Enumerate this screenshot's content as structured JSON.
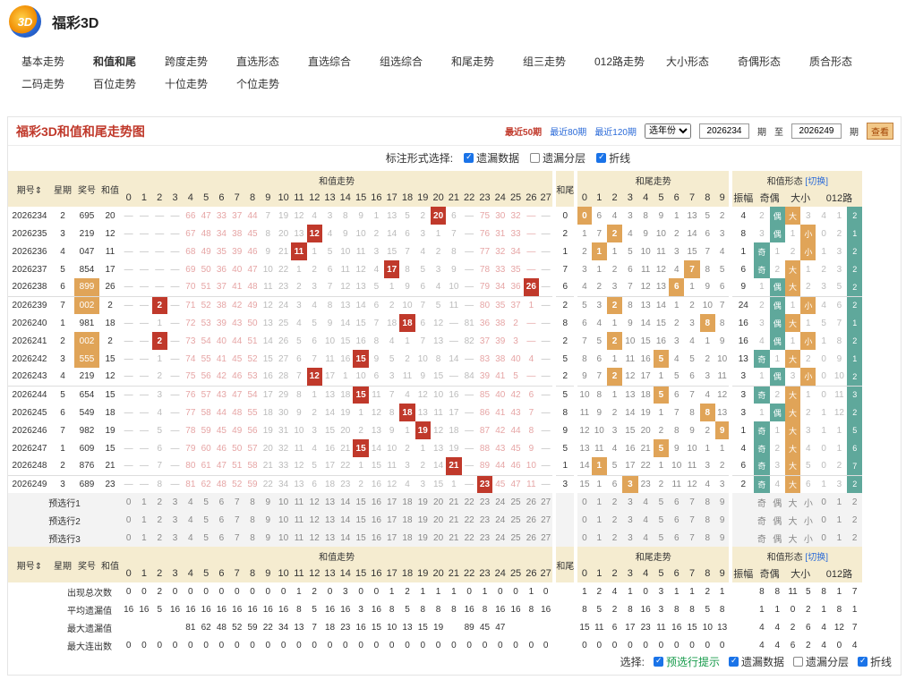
{
  "brand": {
    "logo": "3D",
    "name": "福彩3D"
  },
  "nav": [
    [
      "基本走势",
      "和值和尾",
      "跨度走势",
      "直选形态",
      "直选综合",
      "组选综合",
      "和尾走势",
      "组三走势",
      "012路走势",
      "大小形态",
      "奇偶形态",
      "质合形态"
    ],
    [
      "二码走势",
      "百位走势",
      "十位走势",
      "个位走势"
    ]
  ],
  "panel": {
    "title": "福彩3D和值和尾走势图",
    "p50": "最近50期",
    "p80": "最近80期",
    "p120": "最近120期",
    "year": "选年份",
    "from": "2026234",
    "mid1": "期",
    "to_label": "至",
    "to": "2026249",
    "mid2": "期",
    "go": "查看"
  },
  "opts": {
    "label": "标注形式选择:",
    "o1": "遗漏数据",
    "o2": "遗漏分层",
    "o3": "折线"
  },
  "head": {
    "issue": "期号",
    "week": "星期",
    "num": "奖号",
    "sum": "和值",
    "sumtrend": "和值走势",
    "tail": "和尾",
    "tailtrend": "和尾走势",
    "form": "和值形态",
    "switch": "[切换]",
    "amp": "振幅",
    "oe": "奇偶",
    "bs": "大小",
    "r012": "012路"
  },
  "rows": [
    {
      "i": "2026234",
      "w": "2",
      "n": "695",
      "s": 20,
      "miss": [
        "—",
        "—",
        "—",
        "—",
        "66",
        "47",
        "33",
        "37",
        "44",
        "7",
        "19",
        "12",
        "4",
        "3",
        "8",
        "9",
        "1",
        "13",
        "5",
        "2",
        "20",
        "6",
        "—",
        "75",
        "30",
        "32",
        "—",
        "—"
      ],
      "t": 0,
      "tm": [
        "0",
        "6",
        "4",
        "3",
        "8",
        "9",
        "1",
        "13",
        "5",
        "2"
      ],
      "a": "4",
      "oe": [
        "2",
        "偶"
      ],
      "bs": [
        "大",
        "3"
      ],
      "r": [
        "4",
        "1",
        "2"
      ]
    },
    {
      "i": "2026235",
      "w": "3",
      "n": "219",
      "s": 12,
      "miss": [
        "—",
        "—",
        "—",
        "—",
        "67",
        "48",
        "34",
        "38",
        "45",
        "8",
        "20",
        "13",
        "12",
        "4",
        "9",
        "10",
        "2",
        "14",
        "6",
        "3",
        "1",
        "7",
        "—",
        "76",
        "31",
        "33",
        "—",
        "—"
      ],
      "t": 2,
      "tm": [
        "1",
        "7",
        "2",
        "4",
        "9",
        "10",
        "2",
        "14",
        "6",
        "3"
      ],
      "a": "8",
      "oe": [
        "3",
        "偶"
      ],
      "bs": [
        "1",
        "小"
      ],
      "r": [
        "0",
        "2",
        "1"
      ]
    },
    {
      "i": "2026236",
      "w": "4",
      "n": "047",
      "s": 11,
      "miss": [
        "—",
        "—",
        "—",
        "—",
        "68",
        "49",
        "35",
        "39",
        "46",
        "9",
        "21",
        "11",
        "1",
        "5",
        "10",
        "11",
        "3",
        "15",
        "7",
        "4",
        "2",
        "8",
        "—",
        "77",
        "32",
        "34",
        "—",
        "—"
      ],
      "t": 1,
      "tm": [
        "2",
        "1",
        "1",
        "5",
        "10",
        "11",
        "3",
        "15",
        "7",
        "4"
      ],
      "a": "1",
      "oe": [
        "奇",
        "1"
      ],
      "bs": [
        "2",
        "小"
      ],
      "r": [
        "1",
        "3",
        "2"
      ]
    },
    {
      "i": "2026237",
      "w": "5",
      "n": "854",
      "s": 17,
      "miss": [
        "—",
        "—",
        "—",
        "—",
        "69",
        "50",
        "36",
        "40",
        "47",
        "10",
        "22",
        "1",
        "2",
        "6",
        "11",
        "12",
        "4",
        "17",
        "8",
        "5",
        "3",
        "9",
        "—",
        "78",
        "33",
        "35",
        "—",
        "—"
      ],
      "t": 7,
      "tm": [
        "3",
        "1",
        "2",
        "6",
        "11",
        "12",
        "4",
        "7",
        "8",
        "5"
      ],
      "a": "6",
      "oe": [
        "奇",
        "2"
      ],
      "bs": [
        "大",
        "1"
      ],
      "r": [
        "2",
        "3",
        "2"
      ]
    },
    {
      "i": "2026238",
      "w": "6",
      "n": "899",
      "s": 26,
      "miss": [
        "—",
        "—",
        "—",
        "—",
        "70",
        "51",
        "37",
        "41",
        "48",
        "11",
        "23",
        "2",
        "3",
        "7",
        "12",
        "13",
        "5",
        "1",
        "9",
        "6",
        "4",
        "10",
        "—",
        "79",
        "34",
        "36",
        "26",
        "—"
      ],
      "t": 6,
      "tm": [
        "4",
        "2",
        "3",
        "7",
        "12",
        "13",
        "6",
        "1",
        "9",
        "6"
      ],
      "a": "9",
      "oe": [
        "1",
        "偶"
      ],
      "bs": [
        "大",
        "2"
      ],
      "r": [
        "3",
        "5",
        "2"
      ]
    },
    {
      "i": "2026239",
      "w": "7",
      "n": "002",
      "s": 2,
      "miss": [
        "—",
        "—",
        "2",
        "—",
        "71",
        "52",
        "38",
        "42",
        "49",
        "12",
        "24",
        "3",
        "4",
        "8",
        "13",
        "14",
        "6",
        "2",
        "10",
        "7",
        "5",
        "11",
        "—",
        "80",
        "35",
        "37",
        "1",
        "—"
      ],
      "t": 2,
      "tm": [
        "5",
        "3",
        "2",
        "8",
        "13",
        "14",
        "1",
        "2",
        "10",
        "7"
      ],
      "a": "24",
      "oe": [
        "2",
        "偶"
      ],
      "bs": [
        "1",
        "小"
      ],
      "r": [
        "4",
        "6",
        "2"
      ]
    },
    {
      "i": "2026240",
      "w": "1",
      "n": "981",
      "s": 18,
      "miss": [
        "—",
        "—",
        "1",
        "—",
        "72",
        "53",
        "39",
        "43",
        "50",
        "13",
        "25",
        "4",
        "5",
        "9",
        "14",
        "15",
        "7",
        "18",
        "8",
        "6",
        "12",
        "—",
        "81",
        "36",
        "38",
        "2",
        "—",
        "—"
      ],
      "t": 8,
      "tm": [
        "6",
        "4",
        "1",
        "9",
        "14",
        "15",
        "2",
        "3",
        "8",
        "8"
      ],
      "a": "16",
      "oe": [
        "3",
        "偶"
      ],
      "bs": [
        "大",
        "1"
      ],
      "r": [
        "5",
        "7",
        "1"
      ]
    },
    {
      "i": "2026241",
      "w": "2",
      "n": "002",
      "s": 2,
      "miss": [
        "—",
        "—",
        "2",
        "—",
        "73",
        "54",
        "40",
        "44",
        "51",
        "14",
        "26",
        "5",
        "6",
        "10",
        "15",
        "16",
        "8",
        "4",
        "1",
        "7",
        "13",
        "—",
        "82",
        "37",
        "39",
        "3",
        "—",
        "—"
      ],
      "t": 2,
      "tm": [
        "7",
        "5",
        "2",
        "10",
        "15",
        "16",
        "3",
        "4",
        "1",
        "9"
      ],
      "a": "16",
      "oe": [
        "4",
        "偶"
      ],
      "bs": [
        "1",
        "小"
      ],
      "r": [
        "1",
        "8",
        "2"
      ]
    },
    {
      "i": "2026242",
      "w": "3",
      "n": "555",
      "s": 15,
      "miss": [
        "—",
        "—",
        "1",
        "—",
        "74",
        "55",
        "41",
        "45",
        "52",
        "15",
        "27",
        "6",
        "7",
        "11",
        "16",
        "15",
        "9",
        "5",
        "2",
        "10",
        "8",
        "14",
        "—",
        "83",
        "38",
        "40",
        "4",
        "—"
      ],
      "t": 5,
      "tm": [
        "8",
        "6",
        "1",
        "11",
        "16",
        "5",
        "4",
        "5",
        "2",
        "10"
      ],
      "a": "13",
      "oe": [
        "奇",
        "1"
      ],
      "bs": [
        "大",
        "2"
      ],
      "r": [
        "0",
        "9",
        "1"
      ]
    },
    {
      "i": "2026243",
      "w": "4",
      "n": "219",
      "s": 12,
      "miss": [
        "—",
        "—",
        "2",
        "—",
        "75",
        "56",
        "42",
        "46",
        "53",
        "16",
        "28",
        "7",
        "12",
        "17",
        "1",
        "10",
        "6",
        "3",
        "11",
        "9",
        "15",
        "—",
        "84",
        "39",
        "41",
        "5",
        "—",
        "—"
      ],
      "t": 2,
      "tm": [
        "9",
        "7",
        "2",
        "12",
        "17",
        "1",
        "5",
        "6",
        "3",
        "11"
      ],
      "a": "3",
      "oe": [
        "1",
        "偶"
      ],
      "bs": [
        "3",
        "小"
      ],
      "r": [
        "0",
        "10",
        "2"
      ]
    },
    {
      "i": "2026244",
      "w": "5",
      "n": "654",
      "s": 15,
      "miss": [
        "—",
        "—",
        "3",
        "—",
        "76",
        "57",
        "43",
        "47",
        "54",
        "17",
        "29",
        "8",
        "1",
        "13",
        "18",
        "15",
        "11",
        "7",
        "4",
        "12",
        "10",
        "16",
        "—",
        "85",
        "40",
        "42",
        "6",
        "—"
      ],
      "t": 5,
      "tm": [
        "10",
        "8",
        "1",
        "13",
        "18",
        "5",
        "6",
        "7",
        "4",
        "12"
      ],
      "a": "3",
      "oe": [
        "奇",
        "2"
      ],
      "bs": [
        "大",
        "1"
      ],
      "r": [
        "0",
        "11",
        "3"
      ]
    },
    {
      "i": "2026245",
      "w": "6",
      "n": "549",
      "s": 18,
      "miss": [
        "—",
        "—",
        "4",
        "—",
        "77",
        "58",
        "44",
        "48",
        "55",
        "18",
        "30",
        "9",
        "2",
        "14",
        "19",
        "1",
        "12",
        "8",
        "18",
        "13",
        "11",
        "17",
        "—",
        "86",
        "41",
        "43",
        "7",
        "—"
      ],
      "t": 8,
      "tm": [
        "11",
        "9",
        "2",
        "14",
        "19",
        "1",
        "7",
        "8",
        "8",
        "13"
      ],
      "a": "3",
      "oe": [
        "1",
        "偶"
      ],
      "bs": [
        "大",
        "2"
      ],
      "r": [
        "1",
        "12",
        "2"
      ]
    },
    {
      "i": "2026246",
      "w": "7",
      "n": "982",
      "s": 19,
      "miss": [
        "—",
        "—",
        "5",
        "—",
        "78",
        "59",
        "45",
        "49",
        "56",
        "19",
        "31",
        "10",
        "3",
        "15",
        "20",
        "2",
        "13",
        "9",
        "1",
        "19",
        "12",
        "18",
        "—",
        "87",
        "42",
        "44",
        "8",
        "—"
      ],
      "t": 9,
      "tm": [
        "12",
        "10",
        "3",
        "15",
        "20",
        "2",
        "8",
        "9",
        "2",
        "9"
      ],
      "a": "1",
      "oe": [
        "奇",
        "1"
      ],
      "bs": [
        "大",
        "3"
      ],
      "r": [
        "1",
        "1",
        "5"
      ]
    },
    {
      "i": "2026247",
      "w": "1",
      "n": "609",
      "s": 15,
      "miss": [
        "—",
        "—",
        "6",
        "—",
        "79",
        "60",
        "46",
        "50",
        "57",
        "20",
        "32",
        "11",
        "4",
        "16",
        "21",
        "15",
        "14",
        "10",
        "2",
        "1",
        "13",
        "19",
        "—",
        "88",
        "43",
        "45",
        "9",
        "—"
      ],
      "t": 5,
      "tm": [
        "13",
        "11",
        "4",
        "16",
        "21",
        "5",
        "9",
        "10",
        "1",
        "1"
      ],
      "a": "4",
      "oe": [
        "奇",
        "2"
      ],
      "bs": [
        "大",
        "4"
      ],
      "r": [
        "0",
        "1",
        "6"
      ]
    },
    {
      "i": "2026248",
      "w": "2",
      "n": "876",
      "s": 21,
      "miss": [
        "—",
        "—",
        "7",
        "—",
        "80",
        "61",
        "47",
        "51",
        "58",
        "21",
        "33",
        "12",
        "5",
        "17",
        "22",
        "1",
        "15",
        "11",
        "3",
        "2",
        "14",
        "21",
        "—",
        "89",
        "44",
        "46",
        "10",
        "—"
      ],
      "t": 1,
      "tm": [
        "14",
        "1",
        "5",
        "17",
        "22",
        "1",
        "10",
        "11",
        "3",
        "2"
      ],
      "a": "6",
      "oe": [
        "奇",
        "3"
      ],
      "bs": [
        "大",
        "5"
      ],
      "r": [
        "0",
        "2",
        "7"
      ]
    },
    {
      "i": "2026249",
      "w": "3",
      "n": "689",
      "s": 23,
      "miss": [
        "—",
        "—",
        "8",
        "—",
        "81",
        "62",
        "48",
        "52",
        "59",
        "22",
        "34",
        "13",
        "6",
        "18",
        "23",
        "2",
        "16",
        "12",
        "4",
        "3",
        "15",
        "1",
        "—",
        "23",
        "45",
        "47",
        "11",
        "—"
      ],
      "t": 3,
      "tm": [
        "15",
        "1",
        "6",
        "3",
        "23",
        "2",
        "11",
        "12",
        "4",
        "3"
      ],
      "a": "2",
      "oe": [
        "奇",
        "4"
      ],
      "bs": [
        "大",
        "6"
      ],
      "r": [
        "1",
        "3",
        "2"
      ]
    }
  ],
  "pre": [
    "预选行1",
    "预选行2",
    "预选行3"
  ],
  "stats": [
    {
      "l": "出现总次数",
      "s": [
        "0",
        "0",
        "2",
        "0",
        "0",
        "0",
        "0",
        "0",
        "0",
        "0",
        "0",
        "1",
        "2",
        "0",
        "3",
        "0",
        "0",
        "1",
        "2",
        "1",
        "1",
        "1",
        "0",
        "1",
        "0",
        "0",
        "1",
        "0"
      ],
      "t": [
        "1",
        "2",
        "4",
        "1",
        "0",
        "3",
        "1",
        "1",
        "2",
        "1"
      ],
      "f": [
        "8",
        "8",
        "11",
        "5",
        "8",
        "1",
        "7"
      ]
    },
    {
      "l": "平均遗漏值",
      "s": [
        "16",
        "16",
        "5",
        "16",
        "16",
        "16",
        "16",
        "16",
        "16",
        "16",
        "16",
        "8",
        "5",
        "16",
        "16",
        "3",
        "16",
        "8",
        "5",
        "8",
        "8",
        "8",
        "16",
        "8",
        "16",
        "16",
        "8",
        "16"
      ],
      "t": [
        "8",
        "5",
        "2",
        "8",
        "16",
        "3",
        "8",
        "8",
        "5",
        "8"
      ],
      "f": [
        "1",
        "1",
        "0",
        "2",
        "1",
        "8",
        "1"
      ]
    },
    {
      "l": "最大遗漏值",
      "s": [
        "",
        "",
        "",
        "",
        "81",
        "62",
        "48",
        "52",
        "59",
        "22",
        "34",
        "13",
        "7",
        "18",
        "23",
        "16",
        "15",
        "10",
        "13",
        "15",
        "19",
        "",
        "89",
        "45",
        "47",
        "",
        "",
        ""
      ],
      "t": [
        "15",
        "11",
        "6",
        "17",
        "23",
        "11",
        "16",
        "15",
        "10",
        "13"
      ],
      "f": [
        "4",
        "4",
        "2",
        "6",
        "4",
        "12",
        "7"
      ]
    },
    {
      "l": "最大连出数",
      "s": [
        "0",
        "0",
        "0",
        "0",
        "0",
        "0",
        "0",
        "0",
        "0",
        "0",
        "0",
        "0",
        "0",
        "0",
        "0",
        "0",
        "0",
        "0",
        "0",
        "0",
        "0",
        "0",
        "0",
        "0",
        "0",
        "0",
        "0",
        "0"
      ],
      "t": [
        "0",
        "0",
        "0",
        "0",
        "0",
        "0",
        "0",
        "0",
        "0",
        "0"
      ],
      "f": [
        "4",
        "4",
        "6",
        "2",
        "4",
        "0",
        "4"
      ]
    }
  ],
  "bottom": {
    "label": "选择:",
    "o1": "预选行提示",
    "o2": "遗漏数据",
    "o3": "遗漏分层",
    "o4": "折线"
  }
}
